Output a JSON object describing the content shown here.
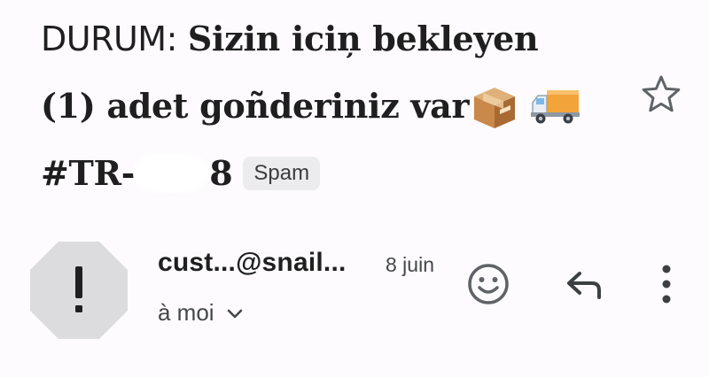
{
  "email": {
    "subject": {
      "status_prefix": "DURUM:",
      "line1_bold": "Sizin iciņ bekleyen",
      "line2_bold": "(1) adet goñderiniz var",
      "line3_bold": "#TR-",
      "line3_tail": "8",
      "box_emoji": "📦",
      "truck_emoji": "🚚"
    },
    "label": "Spam",
    "star_icon": "star-outline-icon",
    "sender": {
      "avatar_icon": "warning-octagon-icon",
      "avatar_glyph": "!",
      "name": "cust...@snail...",
      "date": "8 juin",
      "recipient": "à moi"
    },
    "actions": {
      "react_icon": "emoji-smile-icon",
      "reply_icon": "reply-icon",
      "more_icon": "more-vert-icon"
    }
  },
  "colors": {
    "background": "#fdfbfe",
    "text": "#1f1f1f",
    "secondary_text": "#444746",
    "icon": "#5f6368",
    "badge_bg": "#ececee",
    "avatar_bg": "#dcdcde"
  }
}
